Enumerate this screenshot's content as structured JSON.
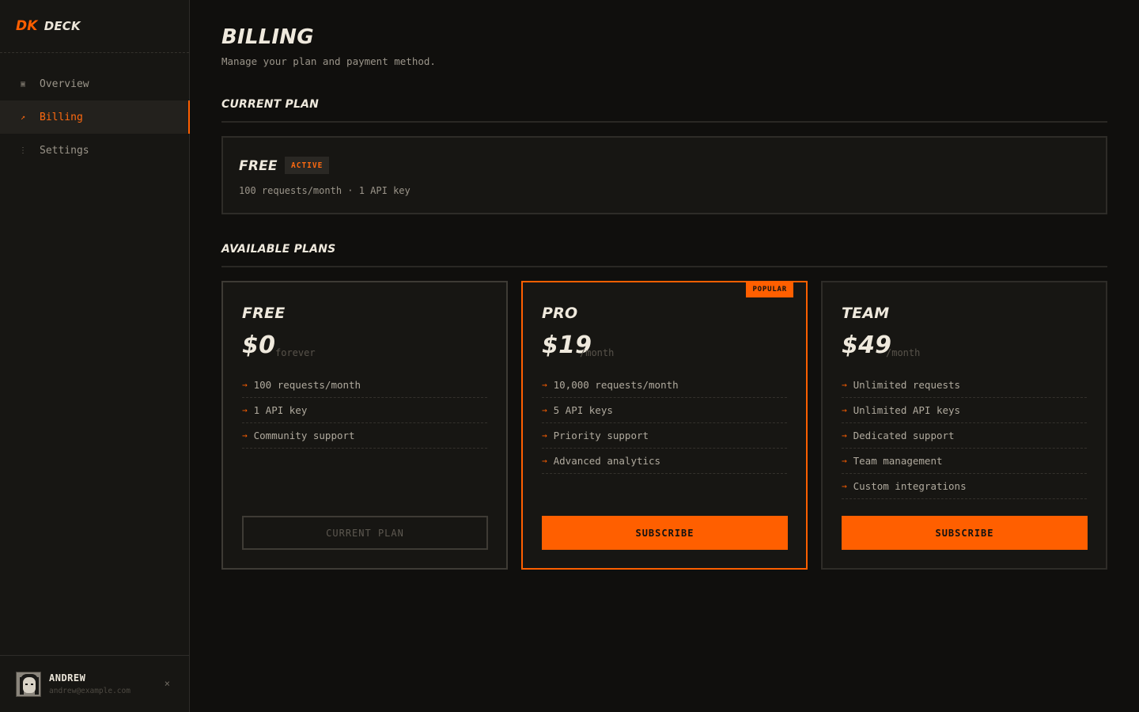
{
  "brand": {
    "mark": "DK",
    "name": "DECK"
  },
  "sidebar": {
    "items": [
      {
        "label": "Overview",
        "icon": "▣"
      },
      {
        "label": "Billing",
        "icon": "↗",
        "active": true
      },
      {
        "label": "Settings",
        "icon": "⋮"
      }
    ]
  },
  "user": {
    "name": "ANDREW",
    "email": "andrew@example.com",
    "logout_icon": "×"
  },
  "page": {
    "title": "BILLING",
    "subtitle": "Manage your plan and payment method."
  },
  "current": {
    "section_title": "CURRENT PLAN",
    "plan_name": "FREE",
    "badge": "ACTIVE",
    "details": "100 requests/month · 1 API key"
  },
  "available": {
    "section_title": "AVAILABLE PLANS",
    "plans": [
      {
        "name": "FREE",
        "price": "$0",
        "period": "forever",
        "features": [
          "100 requests/month",
          "1 API key",
          "Community support"
        ],
        "button": "CURRENT PLAN"
      },
      {
        "name": "PRO",
        "price": "$19",
        "period": "/month",
        "badge": "POPULAR",
        "features": [
          "10,000 requests/month",
          "5 API keys",
          "Priority support",
          "Advanced analytics"
        ],
        "button": "SUBSCRIBE"
      },
      {
        "name": "TEAM",
        "price": "$49",
        "period": "/month",
        "features": [
          "Unlimited requests",
          "Unlimited API keys",
          "Dedicated support",
          "Team management",
          "Custom integrations"
        ],
        "button": "SUBSCRIBE"
      }
    ]
  },
  "colors": {
    "accent": "#ff5f00",
    "background": "#100f0d",
    "panel": "#171613",
    "text": "#efe9dd"
  }
}
